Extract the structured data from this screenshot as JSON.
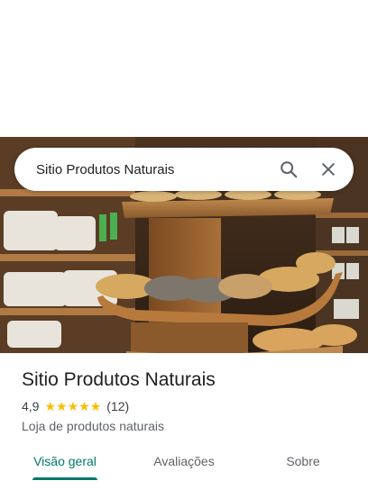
{
  "search": {
    "query": "Sitio Produtos Naturais",
    "search_icon": "search-icon",
    "close_icon": "close-icon"
  },
  "place": {
    "name": "Sitio Produtos Naturais",
    "rating": "4,9",
    "stars_filled": 5,
    "review_count": "(12)",
    "category": "Loja de produtos naturais"
  },
  "tabs": [
    {
      "label": "Visão geral",
      "active": true
    },
    {
      "label": "Avaliações",
      "active": false
    },
    {
      "label": "Sobre",
      "active": false
    }
  ],
  "colors": {
    "accent": "#00796b",
    "star": "#fbbc04"
  }
}
